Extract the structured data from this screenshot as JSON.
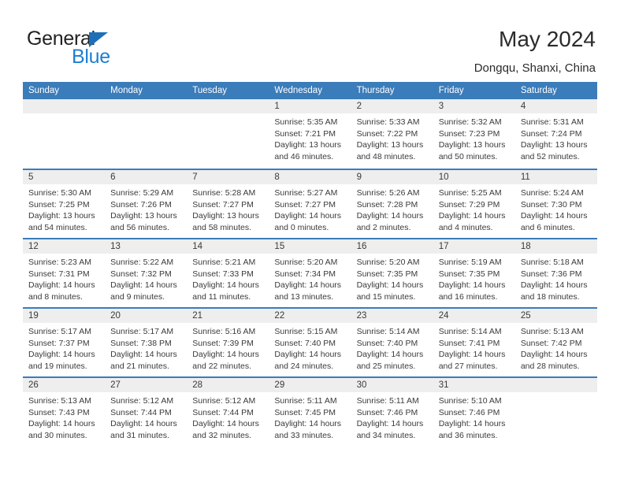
{
  "brand": {
    "name_top": "General",
    "name_bottom": "Blue",
    "triangle_color": "#1d6fb8",
    "blue_text_color": "#1d7fd0"
  },
  "header": {
    "title": "May 2024",
    "subtitle": "Dongqu, Shanxi, China",
    "accent_color": "#3b7cba",
    "daynum_band_color": "#eeeeee"
  },
  "calendar": {
    "weekday_headers": [
      "Sunday",
      "Monday",
      "Tuesday",
      "Wednesday",
      "Thursday",
      "Friday",
      "Saturday"
    ],
    "labels": {
      "sunrise": "Sunrise:",
      "sunset": "Sunset:",
      "daylight": "Daylight:"
    },
    "weeks": [
      [
        {
          "day": "",
          "empty": true
        },
        {
          "day": "",
          "empty": true
        },
        {
          "day": "",
          "empty": true
        },
        {
          "day": "1",
          "sunrise": "Sunrise: 5:35 AM",
          "sunset": "Sunset: 7:21 PM",
          "daylight_1": "Daylight: 13 hours",
          "daylight_2": "and 46 minutes."
        },
        {
          "day": "2",
          "sunrise": "Sunrise: 5:33 AM",
          "sunset": "Sunset: 7:22 PM",
          "daylight_1": "Daylight: 13 hours",
          "daylight_2": "and 48 minutes."
        },
        {
          "day": "3",
          "sunrise": "Sunrise: 5:32 AM",
          "sunset": "Sunset: 7:23 PM",
          "daylight_1": "Daylight: 13 hours",
          "daylight_2": "and 50 minutes."
        },
        {
          "day": "4",
          "sunrise": "Sunrise: 5:31 AM",
          "sunset": "Sunset: 7:24 PM",
          "daylight_1": "Daylight: 13 hours",
          "daylight_2": "and 52 minutes."
        }
      ],
      [
        {
          "day": "5",
          "sunrise": "Sunrise: 5:30 AM",
          "sunset": "Sunset: 7:25 PM",
          "daylight_1": "Daylight: 13 hours",
          "daylight_2": "and 54 minutes."
        },
        {
          "day": "6",
          "sunrise": "Sunrise: 5:29 AM",
          "sunset": "Sunset: 7:26 PM",
          "daylight_1": "Daylight: 13 hours",
          "daylight_2": "and 56 minutes."
        },
        {
          "day": "7",
          "sunrise": "Sunrise: 5:28 AM",
          "sunset": "Sunset: 7:27 PM",
          "daylight_1": "Daylight: 13 hours",
          "daylight_2": "and 58 minutes."
        },
        {
          "day": "8",
          "sunrise": "Sunrise: 5:27 AM",
          "sunset": "Sunset: 7:27 PM",
          "daylight_1": "Daylight: 14 hours",
          "daylight_2": "and 0 minutes."
        },
        {
          "day": "9",
          "sunrise": "Sunrise: 5:26 AM",
          "sunset": "Sunset: 7:28 PM",
          "daylight_1": "Daylight: 14 hours",
          "daylight_2": "and 2 minutes."
        },
        {
          "day": "10",
          "sunrise": "Sunrise: 5:25 AM",
          "sunset": "Sunset: 7:29 PM",
          "daylight_1": "Daylight: 14 hours",
          "daylight_2": "and 4 minutes."
        },
        {
          "day": "11",
          "sunrise": "Sunrise: 5:24 AM",
          "sunset": "Sunset: 7:30 PM",
          "daylight_1": "Daylight: 14 hours",
          "daylight_2": "and 6 minutes."
        }
      ],
      [
        {
          "day": "12",
          "sunrise": "Sunrise: 5:23 AM",
          "sunset": "Sunset: 7:31 PM",
          "daylight_1": "Daylight: 14 hours",
          "daylight_2": "and 8 minutes."
        },
        {
          "day": "13",
          "sunrise": "Sunrise: 5:22 AM",
          "sunset": "Sunset: 7:32 PM",
          "daylight_1": "Daylight: 14 hours",
          "daylight_2": "and 9 minutes."
        },
        {
          "day": "14",
          "sunrise": "Sunrise: 5:21 AM",
          "sunset": "Sunset: 7:33 PM",
          "daylight_1": "Daylight: 14 hours",
          "daylight_2": "and 11 minutes."
        },
        {
          "day": "15",
          "sunrise": "Sunrise: 5:20 AM",
          "sunset": "Sunset: 7:34 PM",
          "daylight_1": "Daylight: 14 hours",
          "daylight_2": "and 13 minutes."
        },
        {
          "day": "16",
          "sunrise": "Sunrise: 5:20 AM",
          "sunset": "Sunset: 7:35 PM",
          "daylight_1": "Daylight: 14 hours",
          "daylight_2": "and 15 minutes."
        },
        {
          "day": "17",
          "sunrise": "Sunrise: 5:19 AM",
          "sunset": "Sunset: 7:35 PM",
          "daylight_1": "Daylight: 14 hours",
          "daylight_2": "and 16 minutes."
        },
        {
          "day": "18",
          "sunrise": "Sunrise: 5:18 AM",
          "sunset": "Sunset: 7:36 PM",
          "daylight_1": "Daylight: 14 hours",
          "daylight_2": "and 18 minutes."
        }
      ],
      [
        {
          "day": "19",
          "sunrise": "Sunrise: 5:17 AM",
          "sunset": "Sunset: 7:37 PM",
          "daylight_1": "Daylight: 14 hours",
          "daylight_2": "and 19 minutes."
        },
        {
          "day": "20",
          "sunrise": "Sunrise: 5:17 AM",
          "sunset": "Sunset: 7:38 PM",
          "daylight_1": "Daylight: 14 hours",
          "daylight_2": "and 21 minutes."
        },
        {
          "day": "21",
          "sunrise": "Sunrise: 5:16 AM",
          "sunset": "Sunset: 7:39 PM",
          "daylight_1": "Daylight: 14 hours",
          "daylight_2": "and 22 minutes."
        },
        {
          "day": "22",
          "sunrise": "Sunrise: 5:15 AM",
          "sunset": "Sunset: 7:40 PM",
          "daylight_1": "Daylight: 14 hours",
          "daylight_2": "and 24 minutes."
        },
        {
          "day": "23",
          "sunrise": "Sunrise: 5:14 AM",
          "sunset": "Sunset: 7:40 PM",
          "daylight_1": "Daylight: 14 hours",
          "daylight_2": "and 25 minutes."
        },
        {
          "day": "24",
          "sunrise": "Sunrise: 5:14 AM",
          "sunset": "Sunset: 7:41 PM",
          "daylight_1": "Daylight: 14 hours",
          "daylight_2": "and 27 minutes."
        },
        {
          "day": "25",
          "sunrise": "Sunrise: 5:13 AM",
          "sunset": "Sunset: 7:42 PM",
          "daylight_1": "Daylight: 14 hours",
          "daylight_2": "and 28 minutes."
        }
      ],
      [
        {
          "day": "26",
          "sunrise": "Sunrise: 5:13 AM",
          "sunset": "Sunset: 7:43 PM",
          "daylight_1": "Daylight: 14 hours",
          "daylight_2": "and 30 minutes."
        },
        {
          "day": "27",
          "sunrise": "Sunrise: 5:12 AM",
          "sunset": "Sunset: 7:44 PM",
          "daylight_1": "Daylight: 14 hours",
          "daylight_2": "and 31 minutes."
        },
        {
          "day": "28",
          "sunrise": "Sunrise: 5:12 AM",
          "sunset": "Sunset: 7:44 PM",
          "daylight_1": "Daylight: 14 hours",
          "daylight_2": "and 32 minutes."
        },
        {
          "day": "29",
          "sunrise": "Sunrise: 5:11 AM",
          "sunset": "Sunset: 7:45 PM",
          "daylight_1": "Daylight: 14 hours",
          "daylight_2": "and 33 minutes."
        },
        {
          "day": "30",
          "sunrise": "Sunrise: 5:11 AM",
          "sunset": "Sunset: 7:46 PM",
          "daylight_1": "Daylight: 14 hours",
          "daylight_2": "and 34 minutes."
        },
        {
          "day": "31",
          "sunrise": "Sunrise: 5:10 AM",
          "sunset": "Sunset: 7:46 PM",
          "daylight_1": "Daylight: 14 hours",
          "daylight_2": "and 36 minutes."
        },
        {
          "day": "",
          "empty": true
        }
      ]
    ]
  }
}
